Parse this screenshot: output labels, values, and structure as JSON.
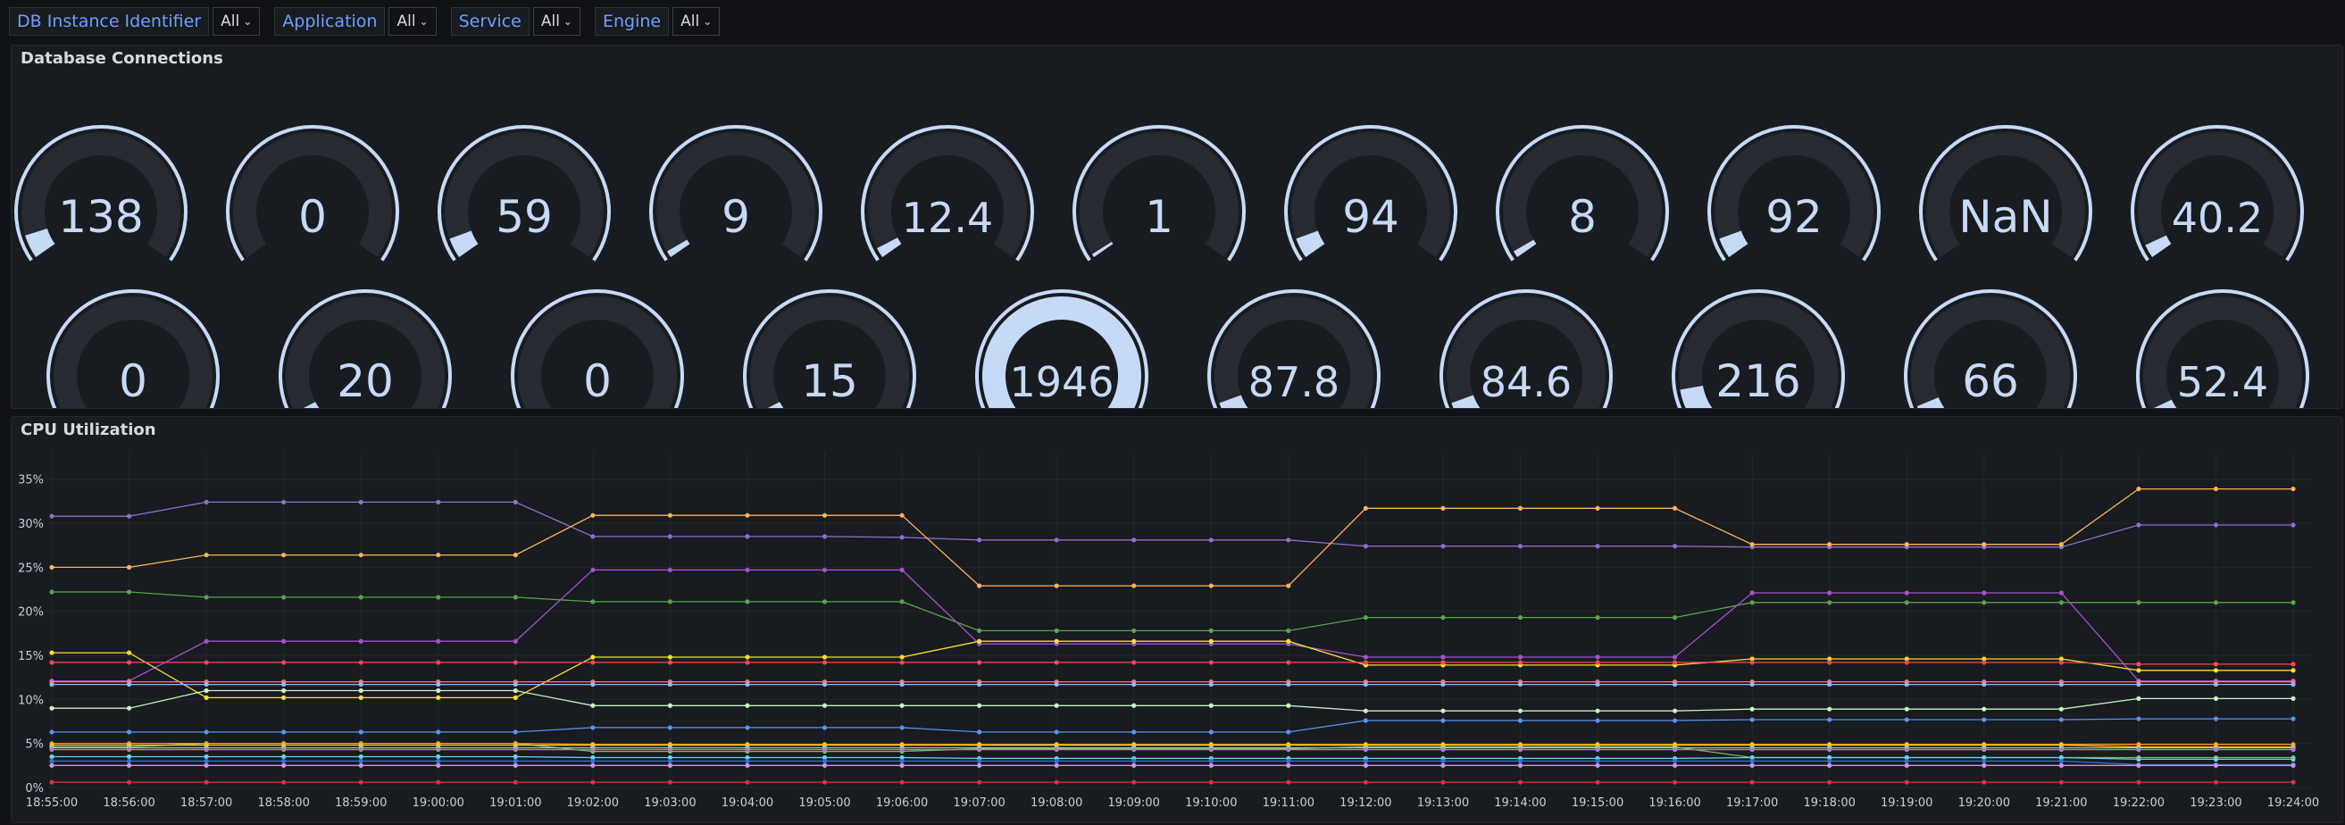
{
  "variables": [
    {
      "label": "DB Instance Identifier",
      "value": "All"
    },
    {
      "label": "Application",
      "value": "All"
    },
    {
      "label": "Service",
      "value": "All"
    },
    {
      "label": "Engine",
      "value": "All"
    }
  ],
  "connections_panel": {
    "title": "Database Connections",
    "gauges": [
      {
        "display": "138",
        "fill": 0.07
      },
      {
        "display": "0",
        "fill": 0
      },
      {
        "display": "59",
        "fill": 0.06
      },
      {
        "display": "9",
        "fill": 0.02
      },
      {
        "display": "12.4",
        "fill": 0.03
      },
      {
        "display": "1",
        "fill": 0.01
      },
      {
        "display": "94",
        "fill": 0.06
      },
      {
        "display": "8",
        "fill": 0.02
      },
      {
        "display": "92",
        "fill": 0.06
      },
      {
        "display": "NaN",
        "fill": 0
      },
      {
        "display": "40.2",
        "fill": 0.04
      },
      {
        "display": "0",
        "fill": 0
      },
      {
        "display": "20",
        "fill": 0.03
      },
      {
        "display": "0",
        "fill": 0
      },
      {
        "display": "15",
        "fill": 0.03
      },
      {
        "display": "1946",
        "fill": 1.0
      },
      {
        "display": "87.8",
        "fill": 0.06
      },
      {
        "display": "84.6",
        "fill": 0.06
      },
      {
        "display": "216",
        "fill": 0.1
      },
      {
        "display": "66",
        "fill": 0.05
      },
      {
        "display": "52.4",
        "fill": 0.04
      }
    ]
  },
  "cpu_panel": {
    "title": "CPU Utilization"
  },
  "chart_data": {
    "type": "line",
    "title": "CPU Utilization",
    "xlabel": "",
    "ylabel": "",
    "ylim": [
      0,
      37
    ],
    "yticks": [
      0,
      5,
      10,
      15,
      20,
      25,
      30,
      35
    ],
    "y_unit": "%",
    "grid": true,
    "x": [
      "18:55:00",
      "18:56:00",
      "18:57:00",
      "18:58:00",
      "18:59:00",
      "19:00:00",
      "19:01:00",
      "19:02:00",
      "19:03:00",
      "19:04:00",
      "19:05:00",
      "19:06:00",
      "19:07:00",
      "19:08:00",
      "19:09:00",
      "19:10:00",
      "19:11:00",
      "19:12:00",
      "19:13:00",
      "19:14:00",
      "19:15:00",
      "19:16:00",
      "19:17:00",
      "19:18:00",
      "19:19:00",
      "19:20:00",
      "19:21:00",
      "19:22:00",
      "19:23:00",
      "19:24:00"
    ],
    "series": [
      {
        "color": "#8f6fce",
        "values": [
          30.8,
          30.8,
          32.4,
          32.4,
          32.4,
          32.4,
          32.4,
          28.5,
          28.5,
          28.5,
          28.5,
          28.4,
          28.1,
          28.1,
          28.1,
          28.1,
          28.1,
          27.4,
          27.4,
          27.4,
          27.4,
          27.4,
          27.3,
          27.3,
          27.3,
          27.3,
          27.3,
          29.8,
          29.8,
          29.8
        ]
      },
      {
        "color": "#ffb357",
        "values": [
          25.0,
          25.0,
          26.4,
          26.4,
          26.4,
          26.4,
          26.4,
          30.9,
          30.9,
          30.9,
          30.9,
          30.9,
          22.9,
          22.9,
          22.9,
          22.9,
          22.9,
          31.7,
          31.7,
          31.7,
          31.7,
          31.7,
          27.6,
          27.6,
          27.6,
          27.6,
          27.6,
          33.9,
          33.9,
          33.9
        ]
      },
      {
        "color": "#56a64b",
        "values": [
          22.2,
          22.2,
          21.6,
          21.6,
          21.6,
          21.6,
          21.6,
          21.1,
          21.1,
          21.1,
          21.1,
          21.1,
          17.8,
          17.8,
          17.8,
          17.8,
          17.8,
          19.3,
          19.3,
          19.3,
          19.3,
          19.3,
          21.0,
          21.0,
          21.0,
          21.0,
          21.0,
          21.0,
          21.0,
          21.0
        ]
      },
      {
        "color": "#a352cc",
        "values": [
          12.1,
          12.1,
          16.6,
          16.6,
          16.6,
          16.6,
          16.6,
          24.7,
          24.7,
          24.7,
          24.7,
          24.7,
          16.3,
          16.3,
          16.3,
          16.3,
          16.3,
          14.8,
          14.8,
          14.8,
          14.8,
          14.8,
          22.1,
          22.1,
          22.1,
          22.1,
          22.1,
          12.1,
          12.1,
          12.1
        ]
      },
      {
        "color": "#fade2a",
        "values": [
          15.3,
          15.3,
          10.2,
          10.2,
          10.2,
          10.2,
          10.2,
          14.8,
          14.8,
          14.8,
          14.8,
          14.8,
          16.6,
          16.6,
          16.6,
          16.6,
          16.6,
          13.9,
          13.9,
          13.9,
          13.9,
          13.9,
          14.6,
          14.6,
          14.6,
          14.6,
          14.6,
          13.3,
          13.3,
          13.3
        ]
      },
      {
        "color": "#f2495c",
        "values": [
          14.2,
          14.2,
          14.2,
          14.2,
          14.2,
          14.2,
          14.2,
          14.2,
          14.2,
          14.2,
          14.2,
          14.2,
          14.2,
          14.2,
          14.2,
          14.2,
          14.2,
          14.2,
          14.2,
          14.2,
          14.2,
          14.2,
          14.2,
          14.2,
          14.2,
          14.2,
          14.2,
          14.0,
          14.0,
          14.0
        ]
      },
      {
        "color": "#ff7383",
        "values": [
          12.0,
          12.0,
          12.0,
          12.0,
          12.0,
          12.0,
          12.0,
          12.0,
          12.0,
          12.0,
          12.0,
          12.0,
          12.0,
          12.0,
          12.0,
          12.0,
          12.0,
          12.0,
          12.0,
          12.0,
          12.0,
          12.0,
          12.0,
          12.0,
          12.0,
          12.0,
          12.0,
          12.0,
          12.0,
          12.0
        ]
      },
      {
        "color": "#c8f2c2",
        "values": [
          9.0,
          9.0,
          11.0,
          11.0,
          11.0,
          11.0,
          11.0,
          9.3,
          9.3,
          9.3,
          9.3,
          9.3,
          9.3,
          9.3,
          9.3,
          9.3,
          9.3,
          8.7,
          8.7,
          8.7,
          8.7,
          8.7,
          8.9,
          8.9,
          8.9,
          8.9,
          8.9,
          10.1,
          10.1,
          10.1
        ]
      },
      {
        "color": "#8ab8ff",
        "values": [
          11.7,
          11.7,
          11.7,
          11.7,
          11.7,
          11.7,
          11.7,
          11.7,
          11.7,
          11.7,
          11.7,
          11.7,
          11.7,
          11.7,
          11.7,
          11.7,
          11.7,
          11.7,
          11.7,
          11.7,
          11.7,
          11.7,
          11.7,
          11.7,
          11.7,
          11.7,
          11.7,
          11.7,
          11.7,
          11.7
        ]
      },
      {
        "color": "#5794f2",
        "values": [
          6.3,
          6.3,
          6.3,
          6.3,
          6.3,
          6.3,
          6.3,
          6.8,
          6.8,
          6.8,
          6.8,
          6.8,
          6.3,
          6.3,
          6.3,
          6.3,
          6.3,
          7.6,
          7.6,
          7.6,
          7.6,
          7.6,
          7.7,
          7.7,
          7.7,
          7.7,
          7.7,
          7.8,
          7.8,
          7.8
        ]
      },
      {
        "color": "#73bf69",
        "values": [
          4.6,
          4.6,
          5.0,
          5.0,
          5.0,
          5.0,
          5.0,
          4.1,
          4.1,
          4.1,
          4.1,
          4.1,
          4.4,
          4.4,
          4.4,
          4.4,
          4.4,
          4.6,
          4.6,
          4.6,
          4.6,
          4.6,
          3.4,
          3.4,
          3.4,
          3.4,
          3.4,
          3.4,
          3.4,
          3.4
        ]
      },
      {
        "color": "#ff9830",
        "values": [
          5.0,
          5.0,
          5.0,
          5.0,
          5.0,
          5.0,
          5.0,
          4.9,
          4.9,
          4.9,
          4.9,
          4.9,
          4.9,
          4.9,
          4.9,
          4.9,
          4.9,
          4.9,
          4.9,
          4.9,
          4.9,
          4.9,
          4.9,
          4.9,
          4.9,
          4.9,
          4.9,
          4.9,
          4.9,
          4.9
        ]
      },
      {
        "color": "#f2cc0c",
        "values": [
          4.8,
          4.8,
          4.8,
          4.8,
          4.8,
          4.8,
          4.8,
          4.8,
          4.8,
          4.8,
          4.8,
          4.8,
          4.8,
          4.8,
          4.8,
          4.8,
          4.8,
          4.8,
          4.8,
          4.8,
          4.8,
          4.8,
          4.8,
          4.8,
          4.8,
          4.8,
          4.8,
          4.6,
          4.6,
          4.6
        ]
      },
      {
        "color": "#96d98d",
        "values": [
          4.5,
          4.5,
          4.5,
          4.5,
          4.5,
          4.5,
          4.5,
          4.5,
          4.5,
          4.5,
          4.5,
          4.5,
          4.5,
          4.5,
          4.5,
          4.5,
          4.5,
          4.5,
          4.5,
          4.5,
          4.5,
          4.5,
          4.5,
          4.5,
          4.5,
          4.5,
          4.5,
          4.5,
          4.5,
          4.5
        ]
      },
      {
        "color": "#b877d9",
        "values": [
          4.3,
          4.3,
          4.3,
          4.3,
          4.3,
          4.3,
          4.3,
          4.3,
          4.3,
          4.3,
          4.3,
          4.3,
          4.3,
          4.3,
          4.3,
          4.3,
          4.3,
          4.3,
          4.3,
          4.3,
          4.3,
          4.3,
          4.3,
          4.3,
          4.3,
          4.3,
          4.3,
          4.3,
          4.3,
          4.3
        ]
      },
      {
        "color": "#6ed0e0",
        "values": [
          3.5,
          3.5,
          3.5,
          3.5,
          3.5,
          3.5,
          3.5,
          3.4,
          3.4,
          3.4,
          3.4,
          3.4,
          3.3,
          3.3,
          3.3,
          3.3,
          3.3,
          3.3,
          3.3,
          3.3,
          3.3,
          3.3,
          3.4,
          3.4,
          3.4,
          3.4,
          3.4,
          3.2,
          3.2,
          3.2
        ]
      },
      {
        "color": "#3274d9",
        "values": [
          3.0,
          3.0,
          3.0,
          3.0,
          3.0,
          3.0,
          3.0,
          3.0,
          3.0,
          3.0,
          3.0,
          3.0,
          3.0,
          3.0,
          3.0,
          3.0,
          3.0,
          3.0,
          3.0,
          3.0,
          3.0,
          3.0,
          3.0,
          3.0,
          3.0,
          3.0,
          3.0,
          2.6,
          2.6,
          2.6
        ]
      },
      {
        "color": "#ca95e5",
        "values": [
          2.5,
          2.5,
          2.5,
          2.5,
          2.5,
          2.5,
          2.5,
          2.5,
          2.5,
          2.5,
          2.5,
          2.5,
          2.5,
          2.5,
          2.5,
          2.5,
          2.5,
          2.5,
          2.5,
          2.5,
          2.5,
          2.5,
          2.5,
          2.5,
          2.5,
          2.5,
          2.5,
          2.5,
          2.5,
          2.5
        ]
      },
      {
        "color": "#e02f44",
        "values": [
          0.6,
          0.6,
          0.6,
          0.6,
          0.6,
          0.6,
          0.6,
          0.6,
          0.6,
          0.6,
          0.6,
          0.6,
          0.6,
          0.6,
          0.6,
          0.6,
          0.6,
          0.6,
          0.6,
          0.6,
          0.6,
          0.6,
          0.6,
          0.6,
          0.6,
          0.6,
          0.6,
          0.6,
          0.6,
          0.6
        ]
      }
    ]
  }
}
